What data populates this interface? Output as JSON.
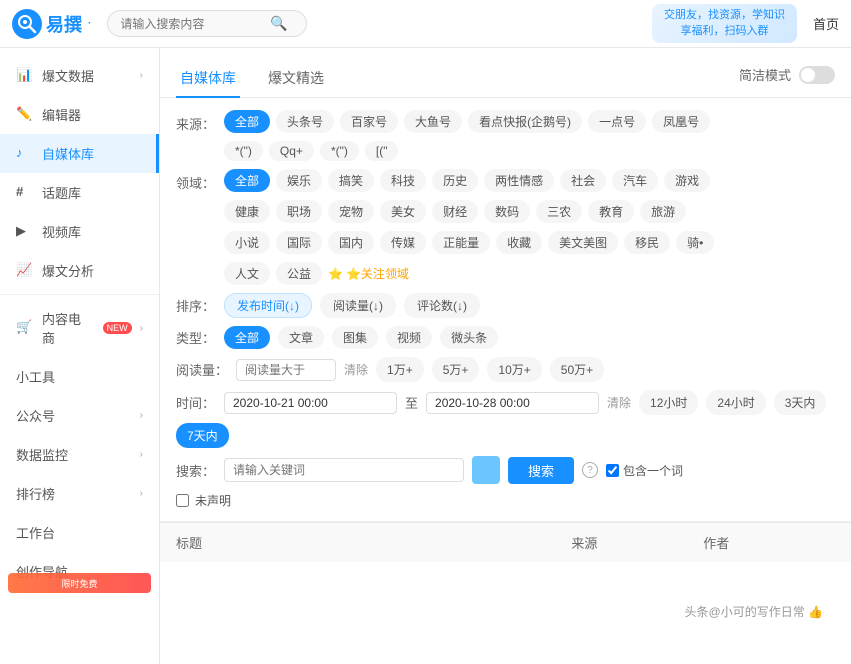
{
  "app": {
    "logo_text": "易撰",
    "logo_symbol": "易",
    "search_placeholder": "请输入搜索内容",
    "nav_home": "首页",
    "banner_line1": "交朋友，找资源，学知识",
    "banner_line2": "享福利，扫码入群"
  },
  "sidebar": {
    "items": [
      {
        "id": "baowen",
        "label": "爆文数据",
        "icon": "📊",
        "arrow": true,
        "active": false
      },
      {
        "id": "bianjiq",
        "label": "编辑器",
        "icon": "✏️",
        "arrow": false,
        "active": false
      },
      {
        "id": "zimeiti",
        "label": "自媒体库",
        "icon": "🎵",
        "arrow": false,
        "active": true
      },
      {
        "id": "huatiku",
        "label": "话题库",
        "icon": "#",
        "arrow": false,
        "active": false
      },
      {
        "id": "shipinku",
        "label": "视频库",
        "icon": "▶",
        "arrow": false,
        "active": false
      },
      {
        "id": "baowenfenxi",
        "label": "爆文分析",
        "icon": "📈",
        "arrow": false,
        "active": false
      },
      {
        "id": "neirong",
        "label": "内容电商",
        "icon": "🛒",
        "badge": "NEW",
        "arrow": true,
        "active": false
      },
      {
        "id": "xiaoworks",
        "label": "小工具",
        "icon": "",
        "arrow": false,
        "active": false
      },
      {
        "id": "gongzhonghao",
        "label": "公众号",
        "icon": "",
        "arrow": true,
        "active": false
      },
      {
        "id": "shujujiankong",
        "label": "数据监控",
        "icon": "",
        "arrow": true,
        "active": false
      },
      {
        "id": "paihang",
        "label": "排行榜",
        "icon": "",
        "arrow": true,
        "active": false
      },
      {
        "id": "gongtai",
        "label": "工作台",
        "icon": "",
        "arrow": false,
        "active": false
      },
      {
        "id": "chuangzuo",
        "label": "创作导航",
        "icon": "",
        "arrow": false,
        "active": false
      }
    ]
  },
  "tabs": [
    {
      "id": "zimeiti-library",
      "label": "自媒体库",
      "active": true
    },
    {
      "id": "baowen-jingxuan",
      "label": "爆文精选",
      "active": false
    },
    {
      "id": "jianjie-mode",
      "label": "简洁模式",
      "active": false,
      "is_toggle": true
    }
  ],
  "filters": {
    "source_label": "来源：",
    "source_options": [
      {
        "id": "all",
        "label": "全部",
        "active": true
      },
      {
        "id": "toutiao",
        "label": "头条号",
        "active": false
      },
      {
        "id": "baijia",
        "label": "百家号",
        "active": false
      },
      {
        "id": "dayu",
        "label": "大鱼号",
        "active": false
      },
      {
        "id": "kandian",
        "label": "看点快报(企鹅号)",
        "active": false
      },
      {
        "id": "yidian",
        "label": "一点号",
        "active": false
      },
      {
        "id": "fenghuang",
        "label": "凤凰号",
        "active": false
      }
    ],
    "source_row2": [
      {
        "id": "wangyi",
        "label": "*(\")",
        "active": false
      },
      {
        "id": "qq",
        "label": "Qq+",
        "active": false
      },
      {
        "id": "souhu",
        "label": "*(\")",
        "active": false
      },
      {
        "id": "bili",
        "label": "[(\"",
        "active": false
      }
    ],
    "domain_label": "领域：",
    "domain_row1": [
      {
        "id": "all",
        "label": "全部",
        "active": true
      },
      {
        "id": "yule",
        "label": "娱乐",
        "active": false
      },
      {
        "id": "gaoxiao",
        "label": "搞笑",
        "active": false
      },
      {
        "id": "keji",
        "label": "科技",
        "active": false
      },
      {
        "id": "lishi",
        "label": "历史",
        "active": false
      },
      {
        "id": "liangsex",
        "label": "两性情感",
        "active": false
      },
      {
        "id": "shehui",
        "label": "社会",
        "active": false
      },
      {
        "id": "qiche",
        "label": "汽车",
        "active": false
      },
      {
        "id": "youxi",
        "label": "游戏",
        "active": false
      }
    ],
    "domain_row2": [
      {
        "id": "jiankang",
        "label": "健康",
        "active": false
      },
      {
        "id": "zhichang",
        "label": "职场",
        "active": false
      },
      {
        "id": "chongwu",
        "label": "宠物",
        "active": false
      },
      {
        "id": "meinv",
        "label": "美女",
        "active": false
      },
      {
        "id": "caijing",
        "label": "财经",
        "active": false
      },
      {
        "id": "shuma",
        "label": "数码",
        "active": false
      },
      {
        "id": "sannong",
        "label": "三农",
        "active": false
      },
      {
        "id": "jiaoyu",
        "label": "教育",
        "active": false
      },
      {
        "id": "lvyou",
        "label": "旅游",
        "active": false
      }
    ],
    "domain_row3": [
      {
        "id": "xiaoshuo",
        "label": "小说",
        "active": false
      },
      {
        "id": "guoji",
        "label": "国际",
        "active": false
      },
      {
        "id": "guonei",
        "label": "国内",
        "active": false
      },
      {
        "id": "chuanmei",
        "label": "传媒",
        "active": false
      },
      {
        "id": "zhengneng",
        "label": "正能量",
        "active": false
      },
      {
        "id": "shoucang",
        "label": "收藏",
        "active": false
      },
      {
        "id": "meiwen",
        "label": "美文美图",
        "active": false
      },
      {
        "id": "yimin",
        "label": "移民",
        "active": false
      },
      {
        "id": "qiche2",
        "label": "骑•",
        "active": false
      }
    ],
    "domain_row4": [
      {
        "id": "renwen",
        "label": "人文",
        "active": false
      },
      {
        "id": "gongyi",
        "label": "公益",
        "active": false
      }
    ],
    "attention_label": "⭐关注领域",
    "sort_label": "排序：",
    "sort_options": [
      {
        "id": "publish_time",
        "label": "发布时间(↓)",
        "active": true
      },
      {
        "id": "read_count",
        "label": "阅读量(↓)",
        "active": false
      },
      {
        "id": "comment_count",
        "label": "评论数(↓)",
        "active": false
      }
    ],
    "type_label": "类型：",
    "type_options": [
      {
        "id": "all",
        "label": "全部",
        "active": true
      },
      {
        "id": "article",
        "label": "文章",
        "active": false
      },
      {
        "id": "gallery",
        "label": "图集",
        "active": false
      },
      {
        "id": "video",
        "label": "视频",
        "active": false
      },
      {
        "id": "microvideo",
        "label": "微头条",
        "active": false
      }
    ],
    "read_label": "阅读量：",
    "read_placeholder": "阅读量大于",
    "read_clear": "清除",
    "read_options": [
      "1万+",
      "5万+",
      "10万+",
      "50万+"
    ],
    "time_label": "时间：",
    "time_start": "2020-10-21 00:00",
    "time_end": "2020-10-28 00:00",
    "time_clear": "清除",
    "time_options": [
      {
        "label": "12小时",
        "active": false
      },
      {
        "label": "24小时",
        "active": false
      },
      {
        "label": "3天内",
        "active": false
      },
      {
        "label": "7天内",
        "active": true
      }
    ],
    "search_label": "搜索：",
    "search_kw_placeholder": "请输入关键词",
    "search_btn_label": "搜索",
    "include_one_word": "包含一个词",
    "declare_label": "未声明"
  },
  "table": {
    "columns": [
      "标题",
      "来源",
      "作者"
    ]
  },
  "watermark": "头条@小可的写作日常 👍"
}
